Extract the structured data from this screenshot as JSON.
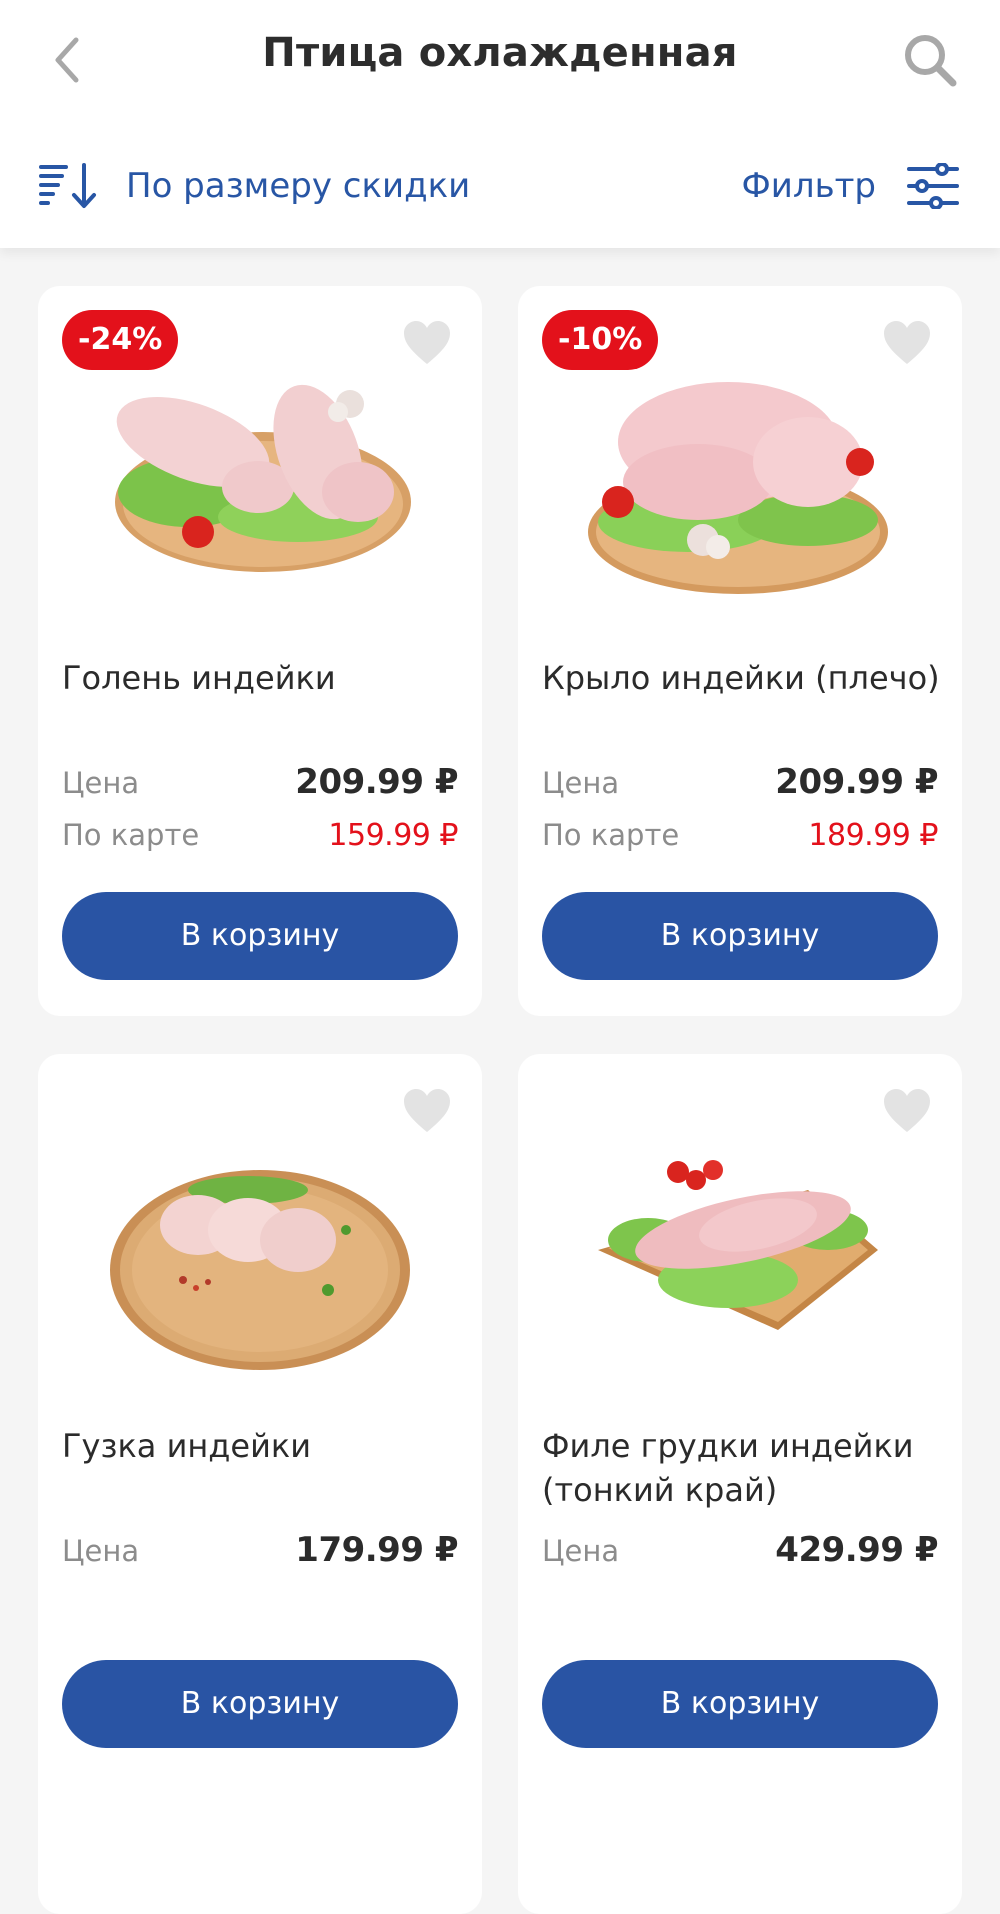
{
  "header": {
    "title": "Птица охлажденная",
    "sort_label": "По размеру скидки",
    "filter_label": "Фильтр"
  },
  "colors": {
    "accent": "#2954a4",
    "discount": "#e3111b",
    "background": "#f5f5f5"
  },
  "products": [
    {
      "name": "Голень индейки",
      "badge": "-24%",
      "price_label": "Цена",
      "price": "209.99 ₽",
      "card_price_label": "По карте",
      "card_price": "159.99 ₽",
      "cart_label": "В корзину",
      "favorite": false
    },
    {
      "name": "Крыло индейки (плечо)",
      "badge": "-10%",
      "price_label": "Цена",
      "price": "209.99 ₽",
      "card_price_label": "По карте",
      "card_price": "189.99 ₽",
      "cart_label": "В корзину",
      "favorite": false
    },
    {
      "name": "Гузка индейки",
      "price_label": "Цена",
      "price": "179.99 ₽",
      "cart_label": "В корзину",
      "favorite": false
    },
    {
      "name": "Филе грудки индейки (тонкий край)",
      "price_label": "Цена",
      "price": "429.99 ₽",
      "cart_label": "В корзину",
      "favorite": false
    }
  ]
}
